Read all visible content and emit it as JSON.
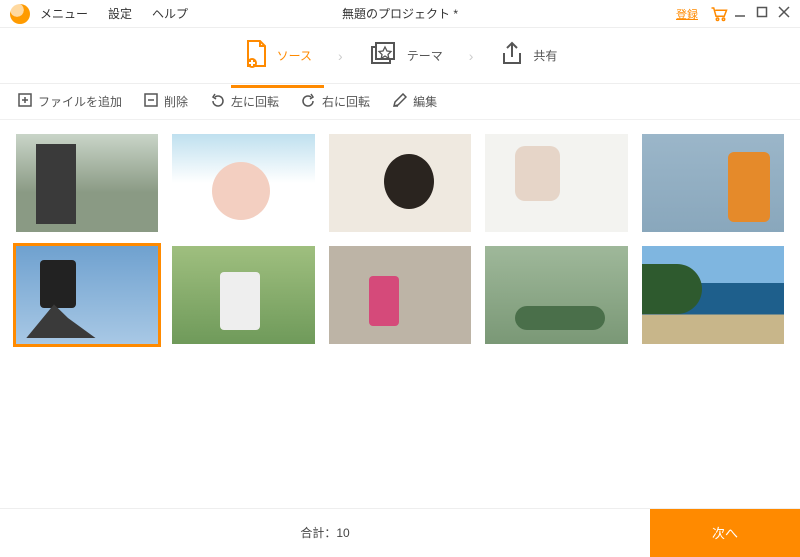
{
  "menubar": {
    "menu": "メニュー",
    "settings": "設定",
    "help": "ヘルプ",
    "title": "無題のプロジェクト *",
    "register": "登録"
  },
  "steps": {
    "source": "ソース",
    "theme": "テーマ",
    "share": "共有"
  },
  "actions": {
    "add_file": "ファイルを追加",
    "delete": "削除",
    "rotate_left": "左に回転",
    "rotate_right": "右に回転",
    "edit": "編集"
  },
  "thumbs": {
    "count": 10,
    "selected_index": 5
  },
  "footer": {
    "total_label": "合計：10",
    "next": "次へ"
  }
}
